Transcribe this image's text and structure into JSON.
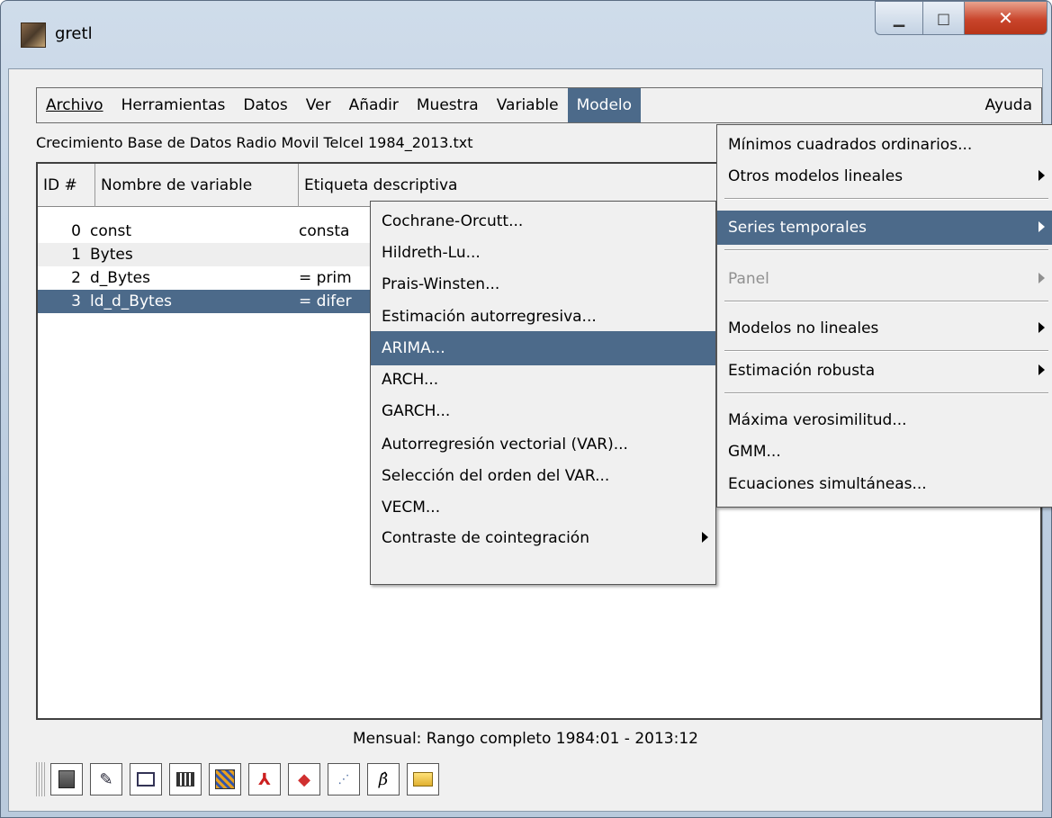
{
  "window": {
    "title": "gretl"
  },
  "menubar": {
    "archivo": "Archivo",
    "herramientas": "Herramientas",
    "datos": "Datos",
    "ver": "Ver",
    "anadir": "Añadir",
    "muestra": "Muestra",
    "variable": "Variable",
    "modelo": "Modelo",
    "ayuda": "Ayuda"
  },
  "dataset_label": "Crecimiento Base de Datos Radio Movil Telcel 1984_2013.txt",
  "table": {
    "headers": {
      "id": "ID #",
      "name": "Nombre de variable",
      "desc": "Etiqueta descriptiva"
    },
    "rows": [
      {
        "id": "0",
        "name": "const",
        "desc": "consta"
      },
      {
        "id": "1",
        "name": "Bytes",
        "desc": ""
      },
      {
        "id": "2",
        "name": "d_Bytes",
        "desc": "= prim"
      },
      {
        "id": "3",
        "name": "ld_d_Bytes",
        "desc": "= difer"
      }
    ]
  },
  "status_text": "Mensual: Rango completo 1984:01 - 2013:12",
  "modelo_menu": {
    "mco": "Mínimos cuadrados ordinarios...",
    "otros_lineales": "Otros modelos lineales",
    "series_temporales": "Series temporales",
    "panel": "Panel",
    "no_lineales": "Modelos no lineales",
    "robusta": "Estimación robusta",
    "max_vero": "Máxima verosimilitud...",
    "gmm": "GMM...",
    "simultaneas": "Ecuaciones simultáneas..."
  },
  "series_submenu": {
    "cochrane": "Cochrane-Orcutt...",
    "hildreth": "Hildreth-Lu...",
    "prais": "Prais-Winsten...",
    "autorregresiva": "Estimación autorregresiva...",
    "arima": "ARIMA...",
    "arch": "ARCH...",
    "garch": "GARCH...",
    "var": "Autorregresión vectorial (VAR)...",
    "orden_var": "Selección del orden del VAR...",
    "vecm": "VECM...",
    "cointegracion": "Contraste de cointegración"
  },
  "icons": [
    "calculator-icon",
    "edit-script-icon",
    "console-icon",
    "session-icon",
    "matrix-icon",
    "pdf-icon",
    "book-icon",
    "plot-icon",
    "beta-icon",
    "folder-icon"
  ],
  "colors": {
    "highlight": "#4c6a8a",
    "menu_bg": "#f0f0f0"
  }
}
